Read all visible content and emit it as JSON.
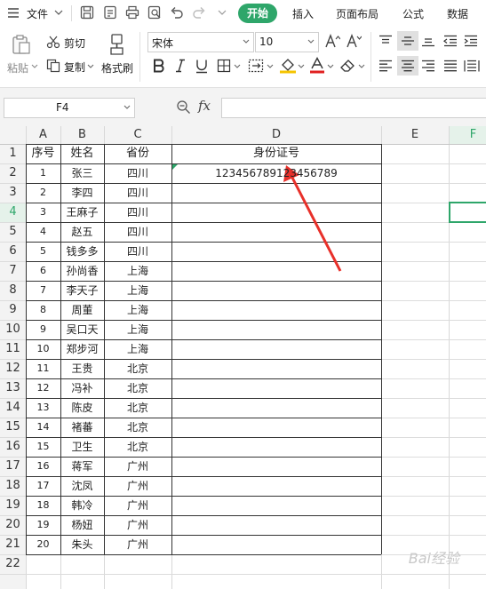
{
  "menubar": {
    "file_label": "文件",
    "tabs": [
      "开始",
      "插入",
      "页面布局",
      "公式",
      "数据"
    ],
    "active_tab": "开始",
    "active_color": "#2ea66a"
  },
  "ribbon": {
    "paste_label": "粘贴",
    "cut_label": "剪切",
    "copy_label": "复制",
    "format_painter_label": "格式刷",
    "font_name": "宋体",
    "font_size": "10",
    "font_color": "#e02020",
    "fill_color": "#f5c400"
  },
  "formula_bar": {
    "cell_ref": "F4",
    "fx_label": "fx",
    "value": ""
  },
  "sheet": {
    "columns": [
      "A",
      "B",
      "C",
      "D",
      "E",
      "F"
    ],
    "row_numbers": [
      "1",
      "2",
      "3",
      "4",
      "5",
      "6",
      "7",
      "8",
      "9",
      "10",
      "11",
      "12",
      "13",
      "14",
      "15",
      "16",
      "17",
      "18",
      "19",
      "20",
      "21",
      "22"
    ],
    "active_row": "4",
    "active_col": "F",
    "header_row": [
      "序号",
      "姓名",
      "省份",
      "身份证号"
    ],
    "rows": [
      [
        "1",
        "张三",
        "四川",
        "123456789123456789"
      ],
      [
        "2",
        "李四",
        "四川",
        ""
      ],
      [
        "3",
        "王麻子",
        "四川",
        ""
      ],
      [
        "4",
        "赵五",
        "四川",
        ""
      ],
      [
        "5",
        "钱多多",
        "四川",
        ""
      ],
      [
        "6",
        "孙尚香",
        "上海",
        ""
      ],
      [
        "7",
        "李天子",
        "上海",
        ""
      ],
      [
        "8",
        "周董",
        "上海",
        ""
      ],
      [
        "9",
        "吴口天",
        "上海",
        ""
      ],
      [
        "10",
        "郑步河",
        "上海",
        ""
      ],
      [
        "11",
        "王贵",
        "北京",
        ""
      ],
      [
        "12",
        "冯补",
        "北京",
        ""
      ],
      [
        "13",
        "陈皮",
        "北京",
        ""
      ],
      [
        "14",
        "褚蕃",
        "北京",
        ""
      ],
      [
        "15",
        "卫生",
        "北京",
        ""
      ],
      [
        "16",
        "蒋军",
        "广州",
        ""
      ],
      [
        "17",
        "沈凤",
        "广州",
        ""
      ],
      [
        "18",
        "韩冷",
        "广州",
        ""
      ],
      [
        "19",
        "杨妞",
        "广州",
        ""
      ],
      [
        "20",
        "朱头",
        "广州",
        ""
      ]
    ]
  },
  "annotation": {
    "arrow_color": "#e8302a"
  },
  "watermark": "Bai经验"
}
